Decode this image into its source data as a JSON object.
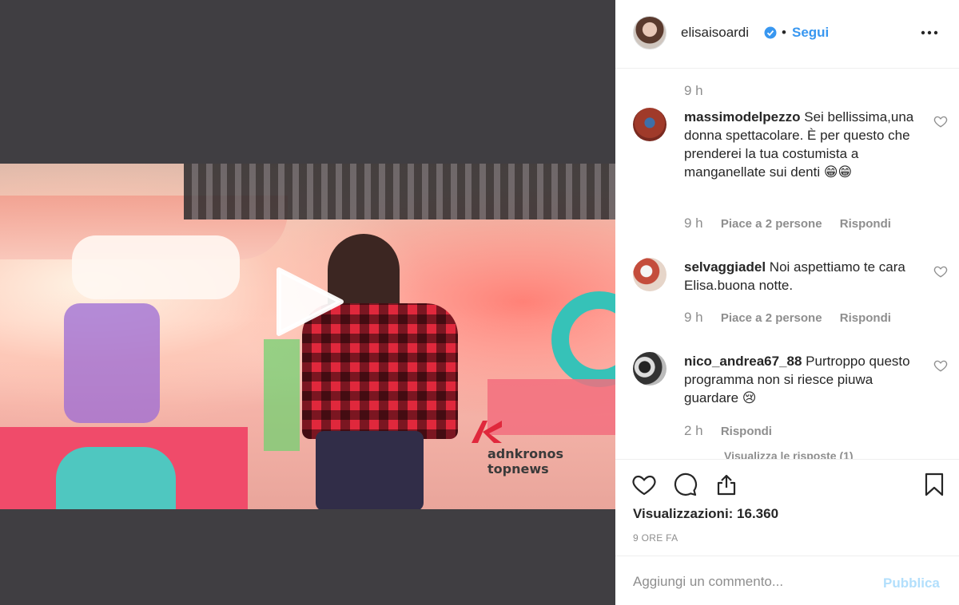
{
  "post": {
    "author": "elisaisoardi",
    "verified": true,
    "separator": "•",
    "follow_label": "Segui"
  },
  "video": {
    "watermark_line1": "adnkronos",
    "watermark_line2": "topnews"
  },
  "comments": {
    "first_time": "9 h",
    "items": [
      {
        "user": "massimodelpezzo",
        "text": "Sei bellissima,una donna spettacolare. È per questo che prenderei la tua costumista a manganellate sui denti 😁😁",
        "time": "9 h",
        "likes": "Piace a 2 persone",
        "reply": "Rispondi"
      },
      {
        "user": "selvaggiadel",
        "text": "Noi aspettiamo te cara Elisa.buona notte.",
        "time": "9 h",
        "likes": "Piace a 2 persone",
        "reply": "Rispondi"
      },
      {
        "user": "nico_andrea67_88",
        "text": "Purtroppo questo programma non si riesce piuwa guardare 😢",
        "time": "2 h",
        "reply": "Rispondi"
      }
    ],
    "view_replies": "Visualizza le risposte (1)"
  },
  "actions": {
    "views_label": "Visualizzazioni: 16.360",
    "posted_ago": "9 ORE FA"
  },
  "composer": {
    "placeholder": "Aggiungi un commento...",
    "publish_label": "Pubblica"
  },
  "colors": {
    "accent": "#3897f0",
    "publish_disabled": "#b2dffc",
    "secondary_text": "#8e8e8e",
    "media_bg": "#403e42"
  }
}
